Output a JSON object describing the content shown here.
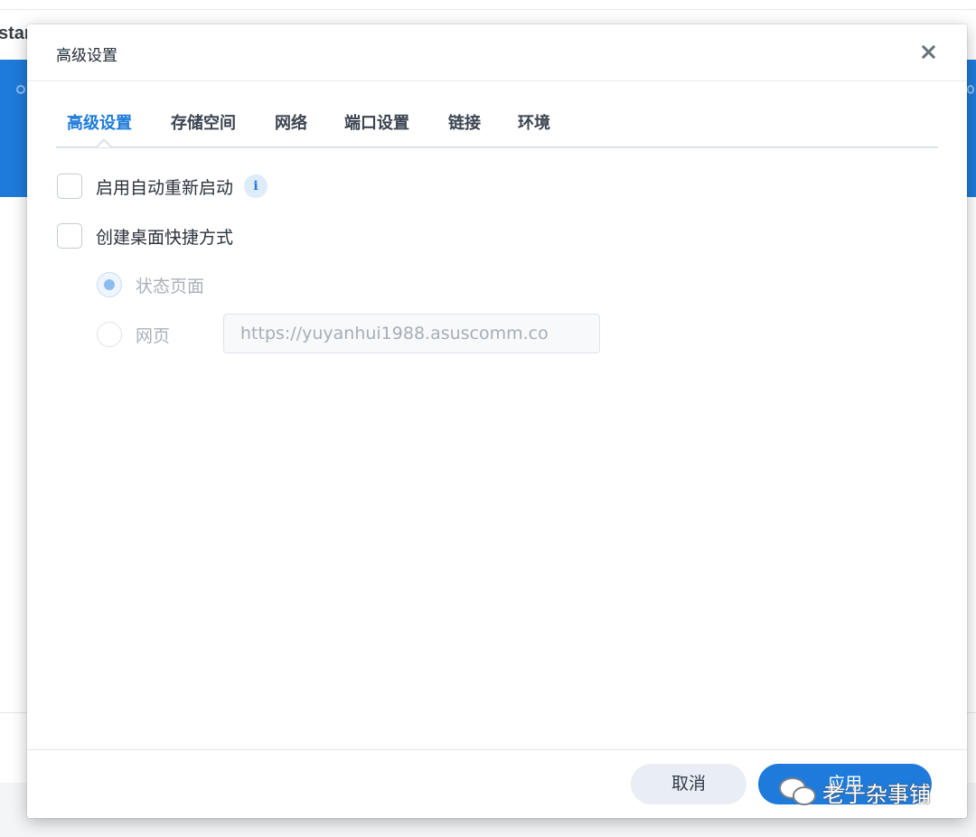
{
  "background": {
    "title_fragment": "star"
  },
  "dialog": {
    "title": "高级设置",
    "tabs": [
      {
        "label": "高级设置",
        "active": true
      },
      {
        "label": "存储空间",
        "active": false
      },
      {
        "label": "网络",
        "active": false
      },
      {
        "label": "端口设置",
        "active": false
      },
      {
        "label": "链接",
        "active": false
      },
      {
        "label": "环境",
        "active": false
      }
    ],
    "options": {
      "auto_restart": {
        "label": "启用自动重新启动",
        "checked": false,
        "info_icon": "i"
      },
      "desktop_shortcut": {
        "label": "创建桌面快捷方式",
        "checked": false
      }
    },
    "shortcut_type": {
      "status_page": {
        "label": "状态页面",
        "selected": true
      },
      "web_page": {
        "label": "网页",
        "selected": false
      },
      "url_value": "https://yuyanhui1988.asuscomm.co"
    },
    "footer": {
      "cancel_label": "取消",
      "apply_label": "应用"
    }
  },
  "watermark": {
    "text": "老于杂事铺"
  },
  "colors": {
    "accent": "#1e7bdb",
    "tab_text": "#3b4451",
    "disabled_text": "#a9b1ba"
  }
}
